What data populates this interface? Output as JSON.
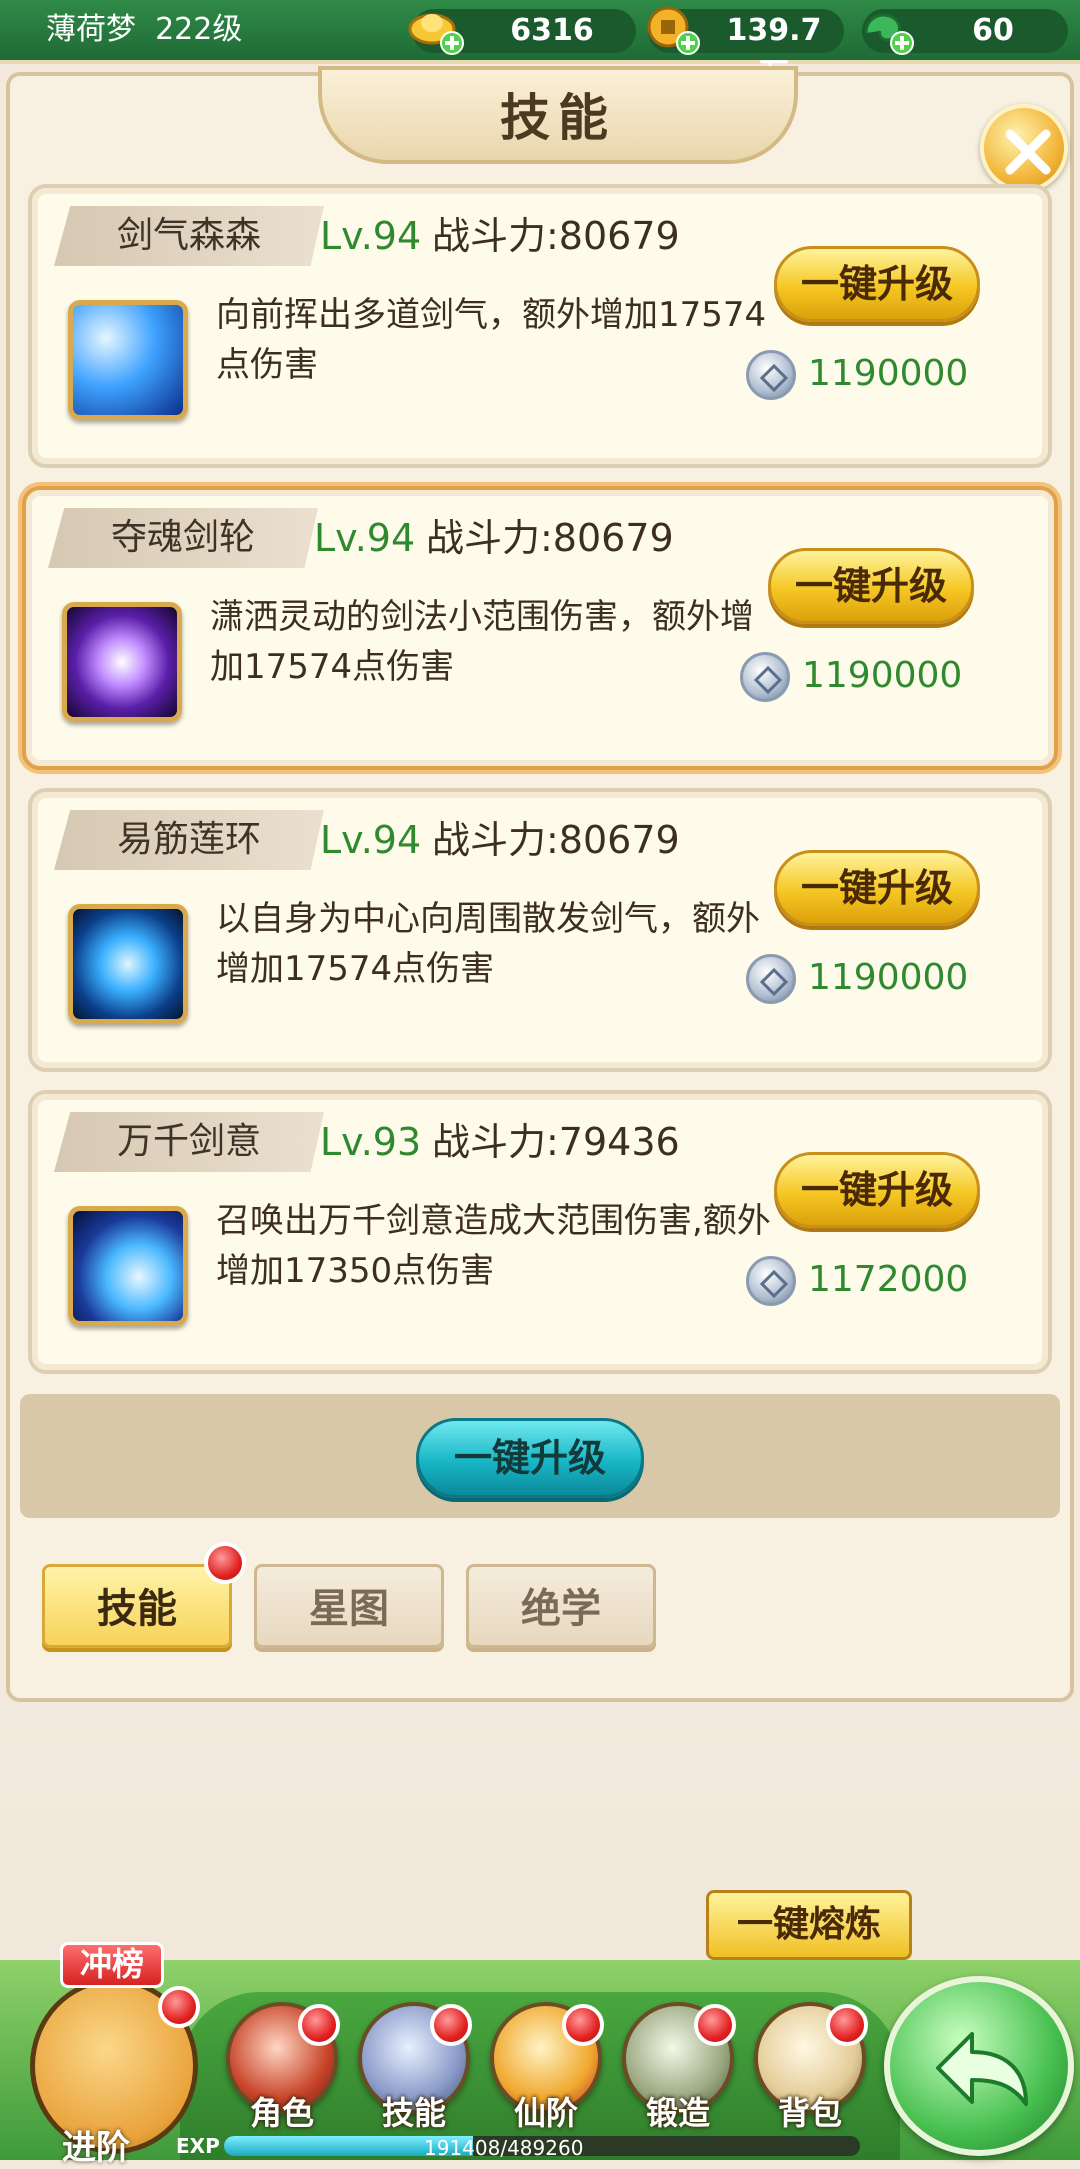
{
  "player": {
    "name": "薄荷梦",
    "level": "222级"
  },
  "resources": [
    {
      "icon": "gold-ingot-icon",
      "value": "6316"
    },
    {
      "icon": "copper-coin-icon",
      "value": "139.7万"
    },
    {
      "icon": "jade-icon",
      "value": "60"
    }
  ],
  "title": "技能",
  "skills": [
    {
      "name": "剑气森森",
      "level": "Lv.94",
      "power": "战斗力:80679",
      "desc": "向前挥出多道剑气，额外增加17574点伤害",
      "button": "一键升级",
      "cost": "1190000",
      "selected": false
    },
    {
      "name": "夺魂剑轮",
      "level": "Lv.94",
      "power": "战斗力:80679",
      "desc": "潇洒灵动的剑法小范围伤害，额外增加17574点伤害",
      "button": "一键升级",
      "cost": "1190000",
      "selected": true
    },
    {
      "name": "易筋莲环",
      "level": "Lv.94",
      "power": "战斗力:80679",
      "desc": "以自身为中心向周围散发剑气，额外增加17574点伤害",
      "button": "一键升级",
      "cost": "1190000",
      "selected": false
    },
    {
      "name": "万千剑意",
      "level": "Lv.93",
      "power": "战斗力:79436",
      "desc": "召唤出万千剑意造成大范围伤害,额外增加17350点伤害",
      "button": "一键升级",
      "cost": "1172000",
      "selected": false
    }
  ],
  "upgrade_all": "一键升级",
  "tabs": [
    {
      "label": "技能",
      "active": true
    },
    {
      "label": "星图",
      "active": false
    },
    {
      "label": "绝学",
      "active": false
    }
  ],
  "melt_button": "一键熔炼",
  "nav": {
    "rank_badge": "冲榜",
    "advance": "进阶",
    "items": [
      "角色",
      "技能",
      "仙阶",
      "锻造",
      "背包"
    ],
    "exp_label": "EXP",
    "exp_text": "191408/489260",
    "exp_fraction": 0.391
  }
}
